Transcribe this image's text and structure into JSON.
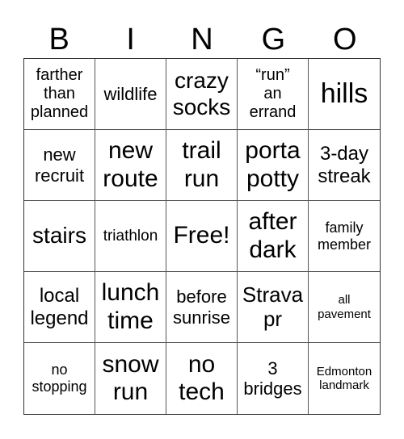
{
  "header": [
    "B",
    "I",
    "N",
    "G",
    "O"
  ],
  "cells": [
    "farther\nthan\nplanned",
    "wildlife",
    "crazy\nsocks",
    "“run”\nan\nerrand",
    "hills",
    "new\nrecruit",
    "new\nroute",
    "trail\nrun",
    "porta\npotty",
    "3-day\nstreak",
    "stairs",
    "triathlon",
    "Free!",
    "after\ndark",
    "family\nmember",
    "local\nlegend",
    "lunch\ntime",
    "before\nsunrise",
    "Strava\npr",
    "all\npavement",
    "no\nstopping",
    "snow\nrun",
    "no\ntech",
    "3\nbridges",
    "Edmonton\nlandmark"
  ]
}
